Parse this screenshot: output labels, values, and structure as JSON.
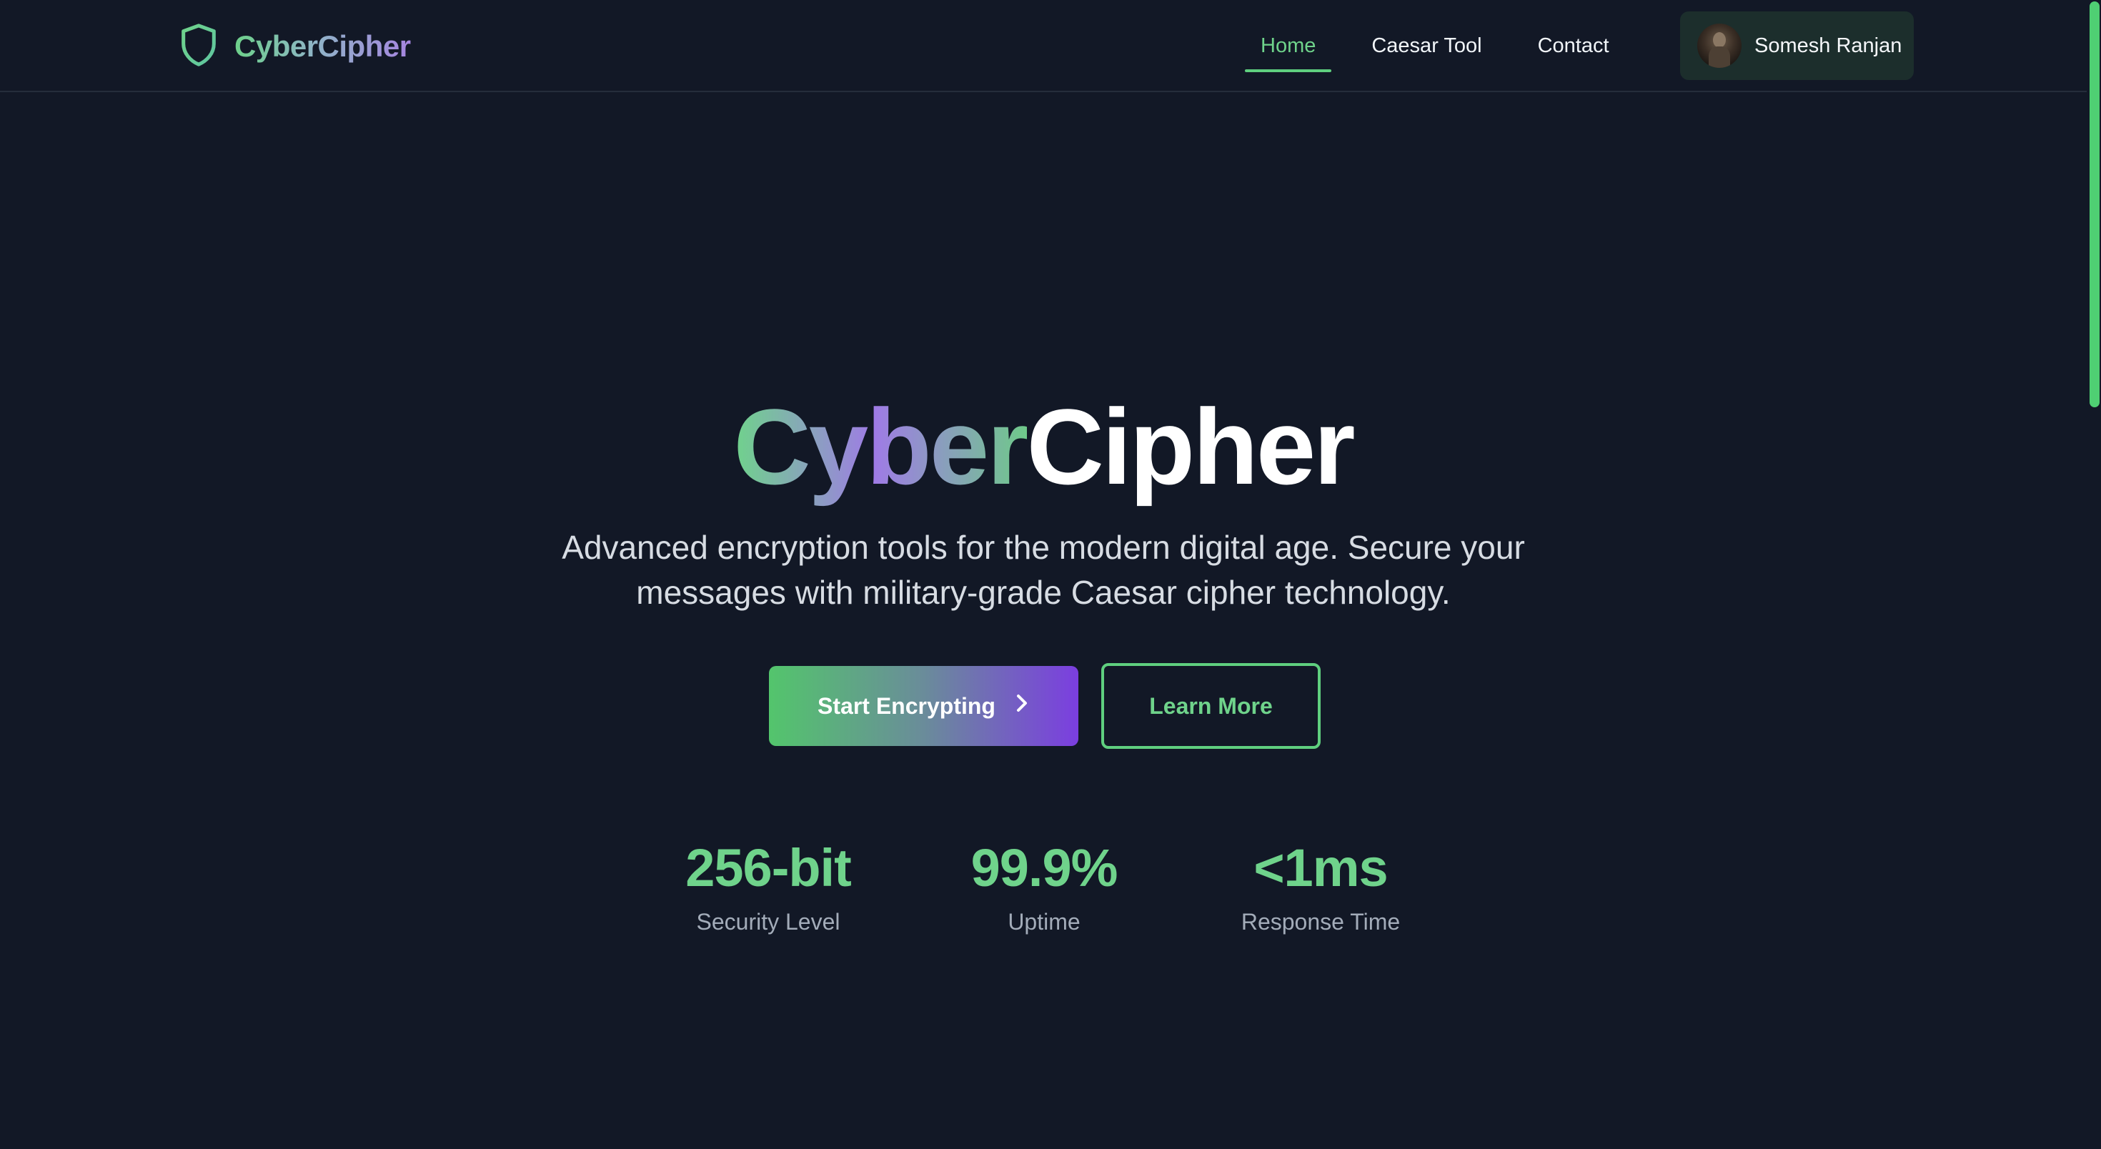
{
  "brand": {
    "name": "CyberCipher",
    "icon": "shield-icon"
  },
  "nav": {
    "items": [
      {
        "label": "Home",
        "active": true
      },
      {
        "label": "Caesar Tool",
        "active": false
      },
      {
        "label": "Contact",
        "active": false
      }
    ]
  },
  "user": {
    "name": "Somesh Ranjan",
    "avatar": "avatar-photo"
  },
  "hero": {
    "title_accent": "Cyber",
    "title_rest": "Cipher",
    "subtitle_line1": "Advanced encryption tools for the modern digital age. Secure your",
    "subtitle_line2": "messages with military-grade Caesar cipher technology."
  },
  "actions": {
    "primary_label": "Start Encrypting",
    "primary_icon": "chevron-right-icon",
    "secondary_label": "Learn More"
  },
  "stats": [
    {
      "value": "256-bit",
      "label": "Security Level"
    },
    {
      "value": "99.9%",
      "label": "Uptime"
    },
    {
      "value": "<1ms",
      "label": "Response Time"
    }
  ],
  "colors": {
    "background": "#121826",
    "accent_green": "#6fd38b",
    "accent_purple": "#7b3ee0",
    "user_chip": "#1c2e2c"
  }
}
